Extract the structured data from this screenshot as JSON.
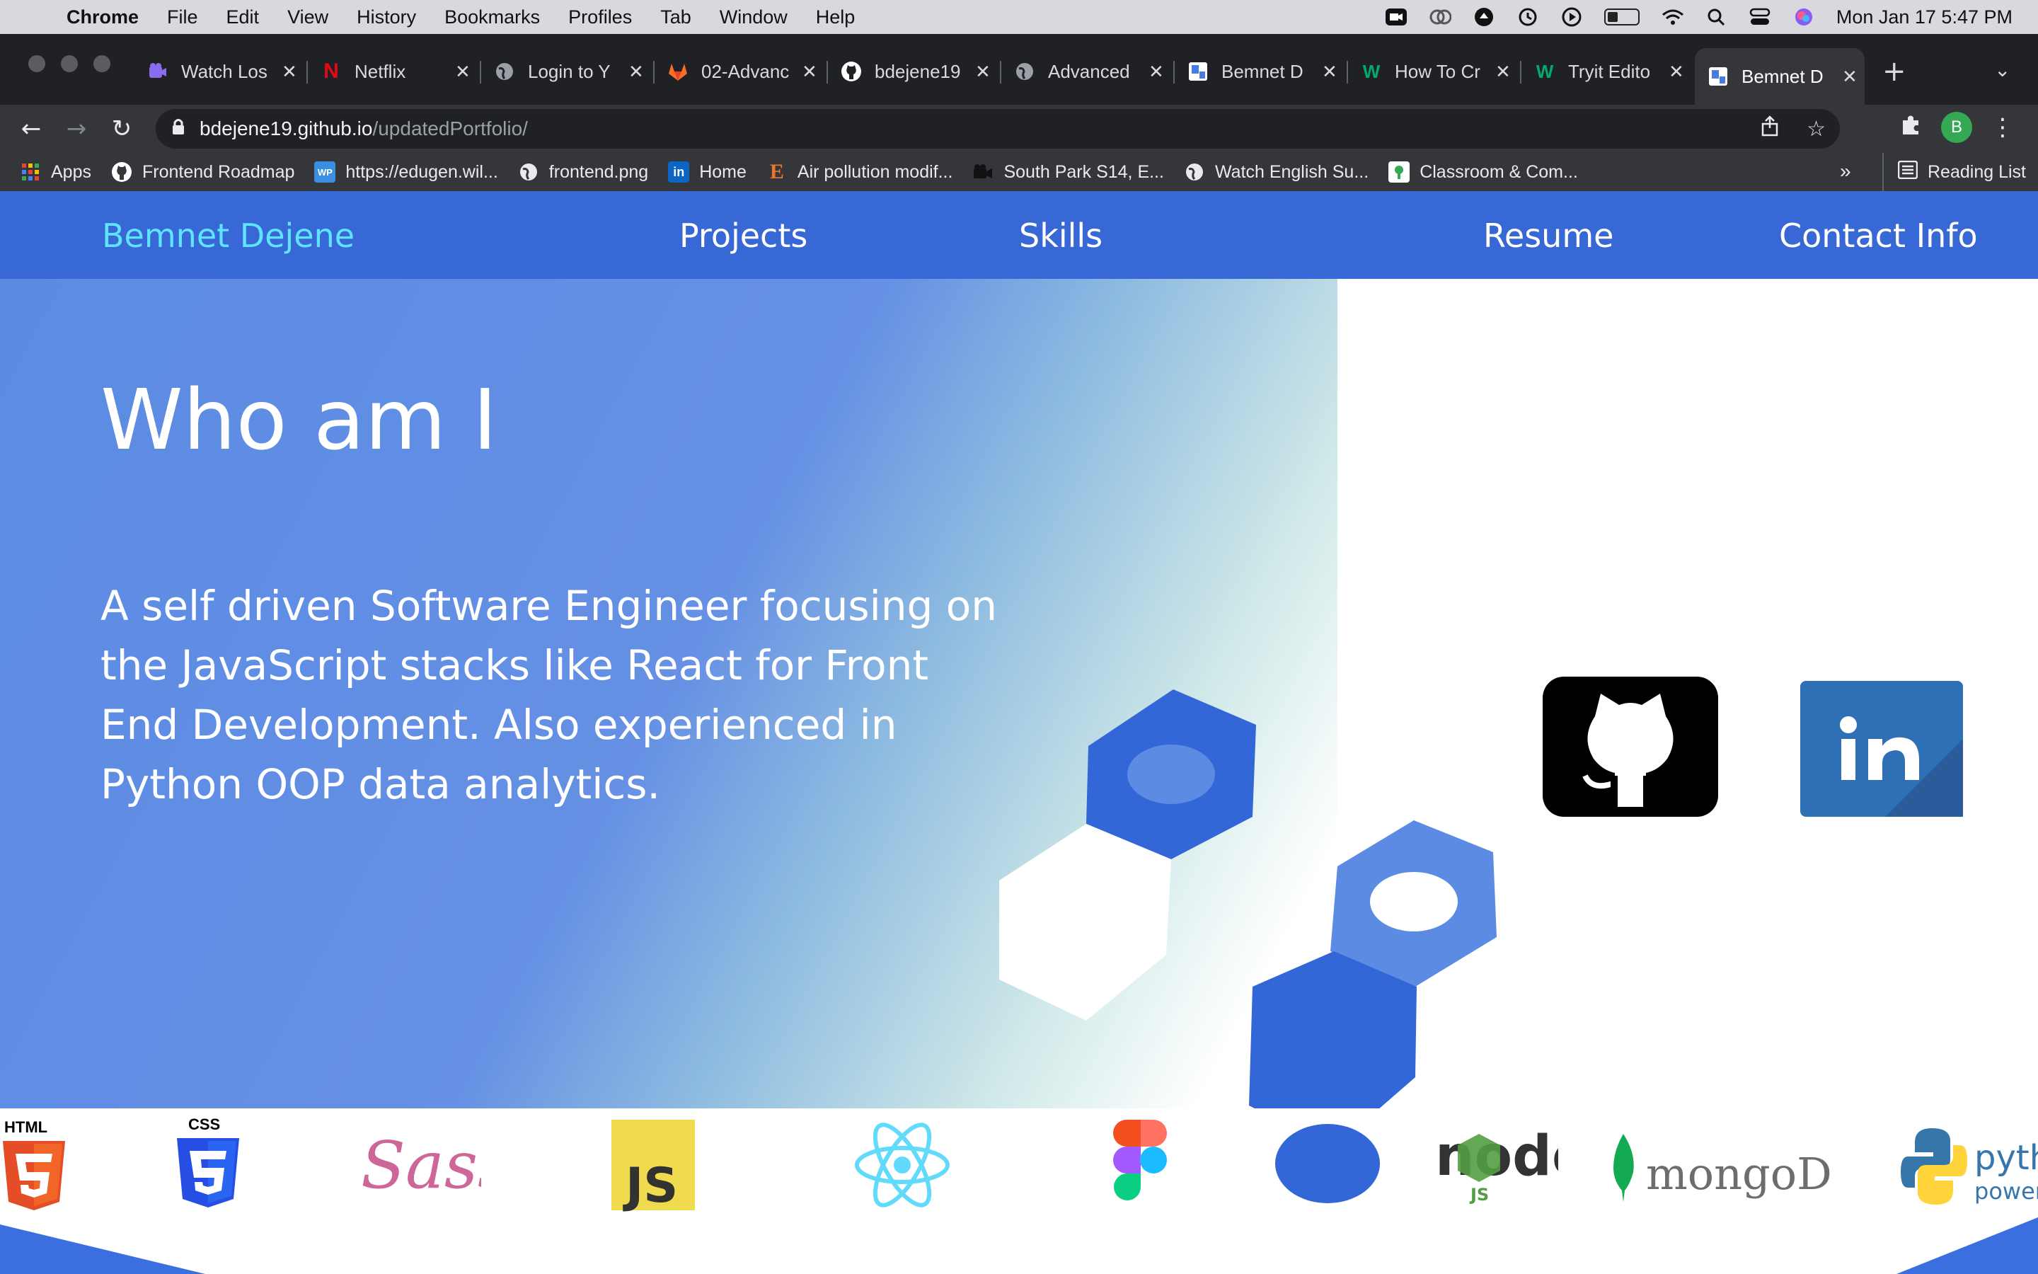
{
  "menubar": {
    "app": "Chrome",
    "items": [
      "File",
      "Edit",
      "View",
      "History",
      "Bookmarks",
      "Profiles",
      "Tab",
      "Window",
      "Help"
    ],
    "clock": "Mon Jan 17  5:47 PM"
  },
  "tabs": [
    {
      "title": "Watch Los",
      "favicon": "video-icon",
      "color": "#8a6cf0"
    },
    {
      "title": "Netflix",
      "favicon": "netflix-icon",
      "color": "#e50914"
    },
    {
      "title": "Login to Y",
      "favicon": "globe-icon",
      "color": "#9aa0a6"
    },
    {
      "title": "02-Advanc",
      "favicon": "gitlab-icon",
      "color": "#fc6d26"
    },
    {
      "title": "bdejene19",
      "favicon": "github-icon",
      "color": "#ffffff"
    },
    {
      "title": "Advanced",
      "favicon": "globe-icon",
      "color": "#9aa0a6"
    },
    {
      "title": "Bemnet D",
      "favicon": "portfolio-icon",
      "color": "#4a7be0"
    },
    {
      "title": "How To Cr",
      "favicon": "w3-icon",
      "color": "#04aa6d"
    },
    {
      "title": "Tryit Edito",
      "favicon": "w3-icon",
      "color": "#04aa6d"
    },
    {
      "title": "Bemnet D",
      "favicon": "portfolio-icon",
      "color": "#4a7be0",
      "active": true
    }
  ],
  "address": {
    "host": "bdejene19.github.io",
    "path": "/updatedPortfolio/"
  },
  "bookmarks": [
    {
      "label": "Apps",
      "icon": "apps-grid-icon"
    },
    {
      "label": "Frontend Roadmap",
      "icon": "github-icon"
    },
    {
      "label": "https://edugen.wil...",
      "icon": "wp-icon"
    },
    {
      "label": "frontend.png",
      "icon": "globe-icon"
    },
    {
      "label": "Home",
      "icon": "linkedin-icon"
    },
    {
      "label": "Air pollution modif...",
      "icon": "e-icon"
    },
    {
      "label": "South Park S14, E...",
      "icon": "camera-icon"
    },
    {
      "label": "Watch English Su...",
      "icon": "globe-icon"
    },
    {
      "label": "Classroom & Com...",
      "icon": "classroom-icon"
    }
  ],
  "bookmarks_more": "»",
  "reading_list": "Reading List",
  "site": {
    "brand": "Bemnet Dejene",
    "nav": [
      "Projects",
      "Skills",
      "Resume",
      "Contact Info"
    ],
    "hero_title": "Who am I",
    "hero_text": "A self driven Software Engineer focusing on the JavaScript stacks like React for Front End Development. Also experienced in Python OOP data analytics.",
    "colors": {
      "nav": "#3868d6",
      "brand": "#5ee4ff",
      "hero": "#5b8be3",
      "hex_dark": "#3366d6",
      "hex_light": "#5b8be3"
    },
    "skills": [
      {
        "name": "html5-icon",
        "label": "HTML"
      },
      {
        "name": "css3-icon",
        "label": "CSS"
      },
      {
        "name": "sass-icon",
        "label": "Sass"
      },
      {
        "name": "javascript-icon",
        "label": "JS"
      },
      {
        "name": "react-icon",
        "label": ""
      },
      {
        "name": "figma-icon",
        "label": ""
      },
      {
        "name": "blank-skill-icon",
        "label": ""
      },
      {
        "name": "nodejs-icon",
        "label": "node"
      },
      {
        "name": "mongodb-icon",
        "label": "mongoDB."
      },
      {
        "name": "python-icon",
        "label": "python"
      }
    ]
  }
}
